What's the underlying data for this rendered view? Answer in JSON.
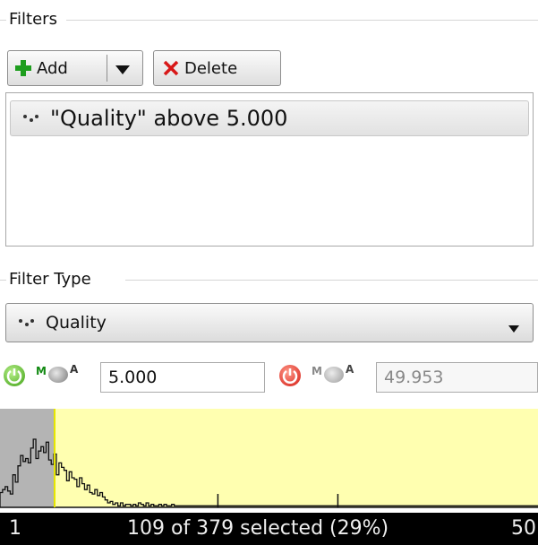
{
  "filters_section": {
    "title": "Filters"
  },
  "toolbar": {
    "add_label": "Add",
    "delete_label": "Delete"
  },
  "filters_list": [
    {
      "text": "\"Quality\" above 5.000",
      "icon": "quality-dots-icon"
    }
  ],
  "filter_type_section": {
    "title": "Filter Type",
    "selected": "Quality"
  },
  "range": {
    "min": {
      "mode": "M",
      "mode_alt": "A",
      "value": "5.000",
      "power": "on"
    },
    "max": {
      "mode": "M",
      "mode_alt": "A",
      "value": "49.953",
      "power": "off"
    }
  },
  "histogram": {
    "selected_color": "#ffffb0",
    "unselected_color": "#b4b4b4",
    "threshold_color": "#e6e600",
    "threshold_fraction": 0.102,
    "bins": [
      10,
      12,
      14,
      11,
      9,
      22,
      17,
      28,
      35,
      31,
      33,
      30,
      40,
      46,
      33,
      38,
      41,
      37,
      44,
      32,
      29,
      36,
      22,
      30,
      27,
      25,
      18,
      24,
      20,
      19,
      14,
      20,
      16,
      12,
      15,
      10,
      9,
      12,
      8,
      10,
      7,
      5,
      3,
      4,
      2,
      3,
      1,
      3,
      1,
      2,
      2,
      1,
      2,
      1,
      3,
      2,
      1,
      3,
      1,
      2,
      1,
      1,
      2,
      1,
      2,
      1,
      1,
      2,
      1,
      1,
      1,
      1,
      1,
      1,
      1,
      1,
      1,
      1,
      1,
      1,
      1,
      1,
      1,
      1,
      1,
      1,
      1,
      1,
      1,
      1,
      1,
      1,
      1,
      1,
      1,
      1,
      1,
      1,
      1,
      1,
      1,
      1,
      1,
      1,
      1,
      1,
      1,
      1,
      1,
      1,
      1,
      1,
      1,
      1,
      1,
      1,
      1,
      1,
      1,
      1,
      1,
      1,
      1,
      1,
      1,
      1,
      1,
      1,
      1,
      1,
      1,
      1,
      1,
      1,
      1,
      1,
      1,
      1,
      1,
      1,
      1,
      1,
      1,
      1,
      1,
      1,
      1,
      1,
      1,
      1,
      1,
      1,
      1,
      1,
      1,
      1,
      1,
      1,
      1,
      1,
      1,
      1,
      1,
      1,
      1,
      1,
      1,
      1,
      1,
      1,
      1,
      1,
      1,
      1,
      1,
      1,
      1,
      1,
      1,
      1,
      1,
      1,
      1,
      1,
      1,
      1,
      1,
      1,
      1,
      1,
      1,
      1,
      1,
      1,
      1,
      1,
      1,
      1,
      1,
      1,
      1,
      1,
      1,
      1,
      1,
      1,
      1,
      1,
      1,
      1
    ],
    "sparse_spikes": [
      {
        "bin_fraction": 0.405,
        "count": 3
      },
      {
        "bin_fraction": 0.628,
        "count": 3
      }
    ]
  },
  "status": {
    "min_label": "1",
    "summary": "109 of 379 selected (29%)",
    "max_label": "50"
  }
}
